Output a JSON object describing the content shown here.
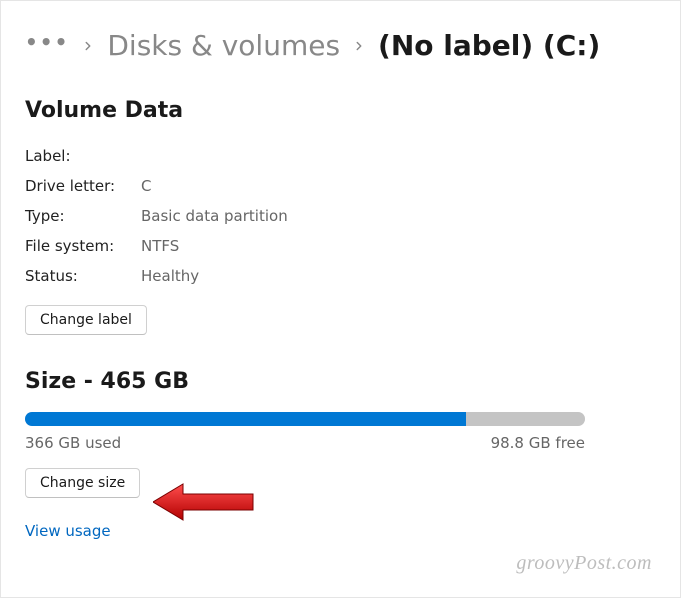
{
  "breadcrumb": {
    "parent": "Disks & volumes",
    "current": "(No label) (C:)"
  },
  "volumeData": {
    "title": "Volume Data",
    "labelKey": "Label:",
    "labelVal": "",
    "driveLetterKey": "Drive letter:",
    "driveLetterVal": "C",
    "typeKey": "Type:",
    "typeVal": "Basic data partition",
    "fileSystemKey": "File system:",
    "fileSystemVal": "NTFS",
    "statusKey": "Status:",
    "statusVal": "Healthy",
    "changeLabelBtn": "Change label"
  },
  "size": {
    "title": "Size - 465 GB",
    "usedPercent": 78.7,
    "usedLabel": "366 GB used",
    "freeLabel": "98.8 GB free",
    "changeSizeBtn": "Change size"
  },
  "viewUsageLink": "View usage",
  "watermark": "groovyPost.com"
}
